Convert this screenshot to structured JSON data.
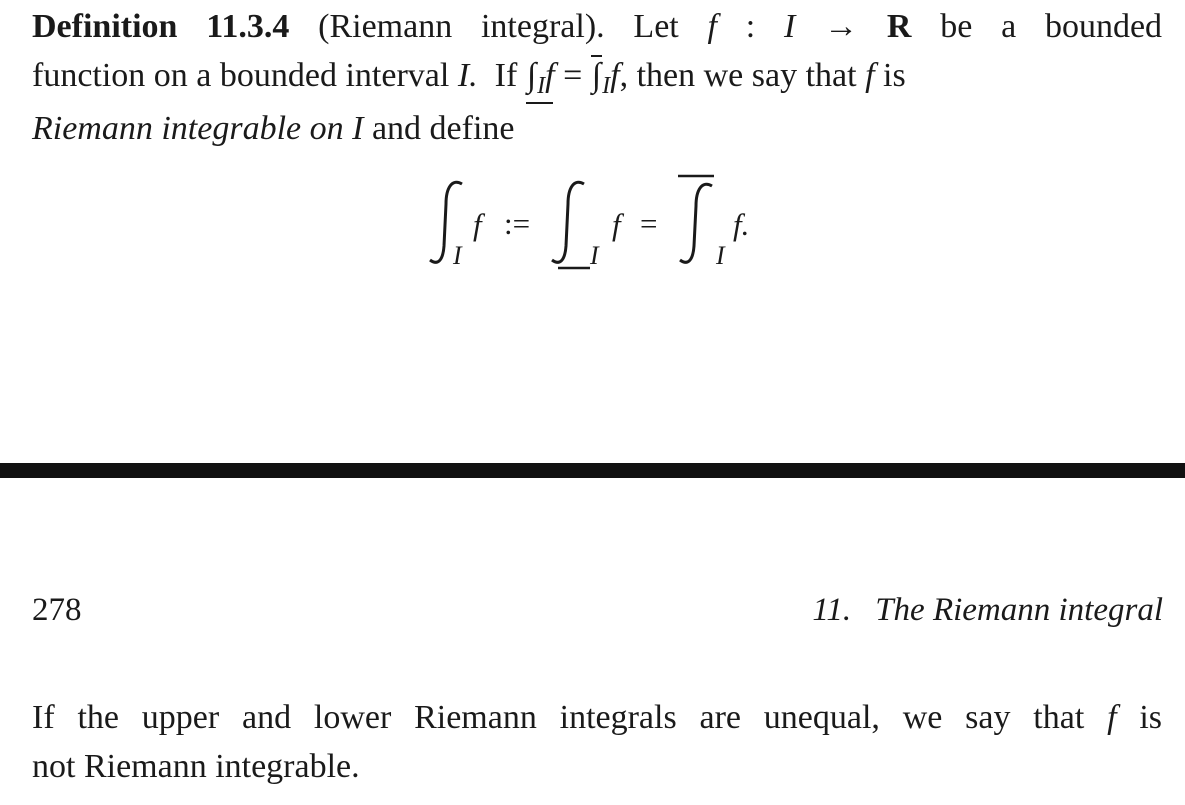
{
  "definition": {
    "label": "Definition 11.3.4",
    "title": "(Riemann integral).",
    "line1_text1": "Let",
    "function_f": "f",
    "colon": ":",
    "interval_I": "I",
    "arrow": "→",
    "reals": "R",
    "line1_text2": "be a bounded",
    "line2_text1": "function on a bounded interval",
    "line2_text2": "I.",
    "line2_if": "If",
    "integral_sign": "∫",
    "equals": "=",
    "line2_text3": ", then we say that",
    "line2_text4": "is",
    "line3_emph": "Riemann integrable on I",
    "line3_text": "and define"
  },
  "display_equation": {
    "integrand": "f",
    "define_op": ":=",
    "equals": "=",
    "subscript": "I",
    "final_integrand": "f."
  },
  "page_header": {
    "page_number": "278",
    "chapter_number": "11.",
    "chapter_title": "The Riemann integral"
  },
  "continuation": {
    "line1": "If the upper and lower Riemann integrals are unequal, we say that",
    "function_f": "f",
    "line1_end": "is",
    "line2": "not Riemann integrable."
  }
}
